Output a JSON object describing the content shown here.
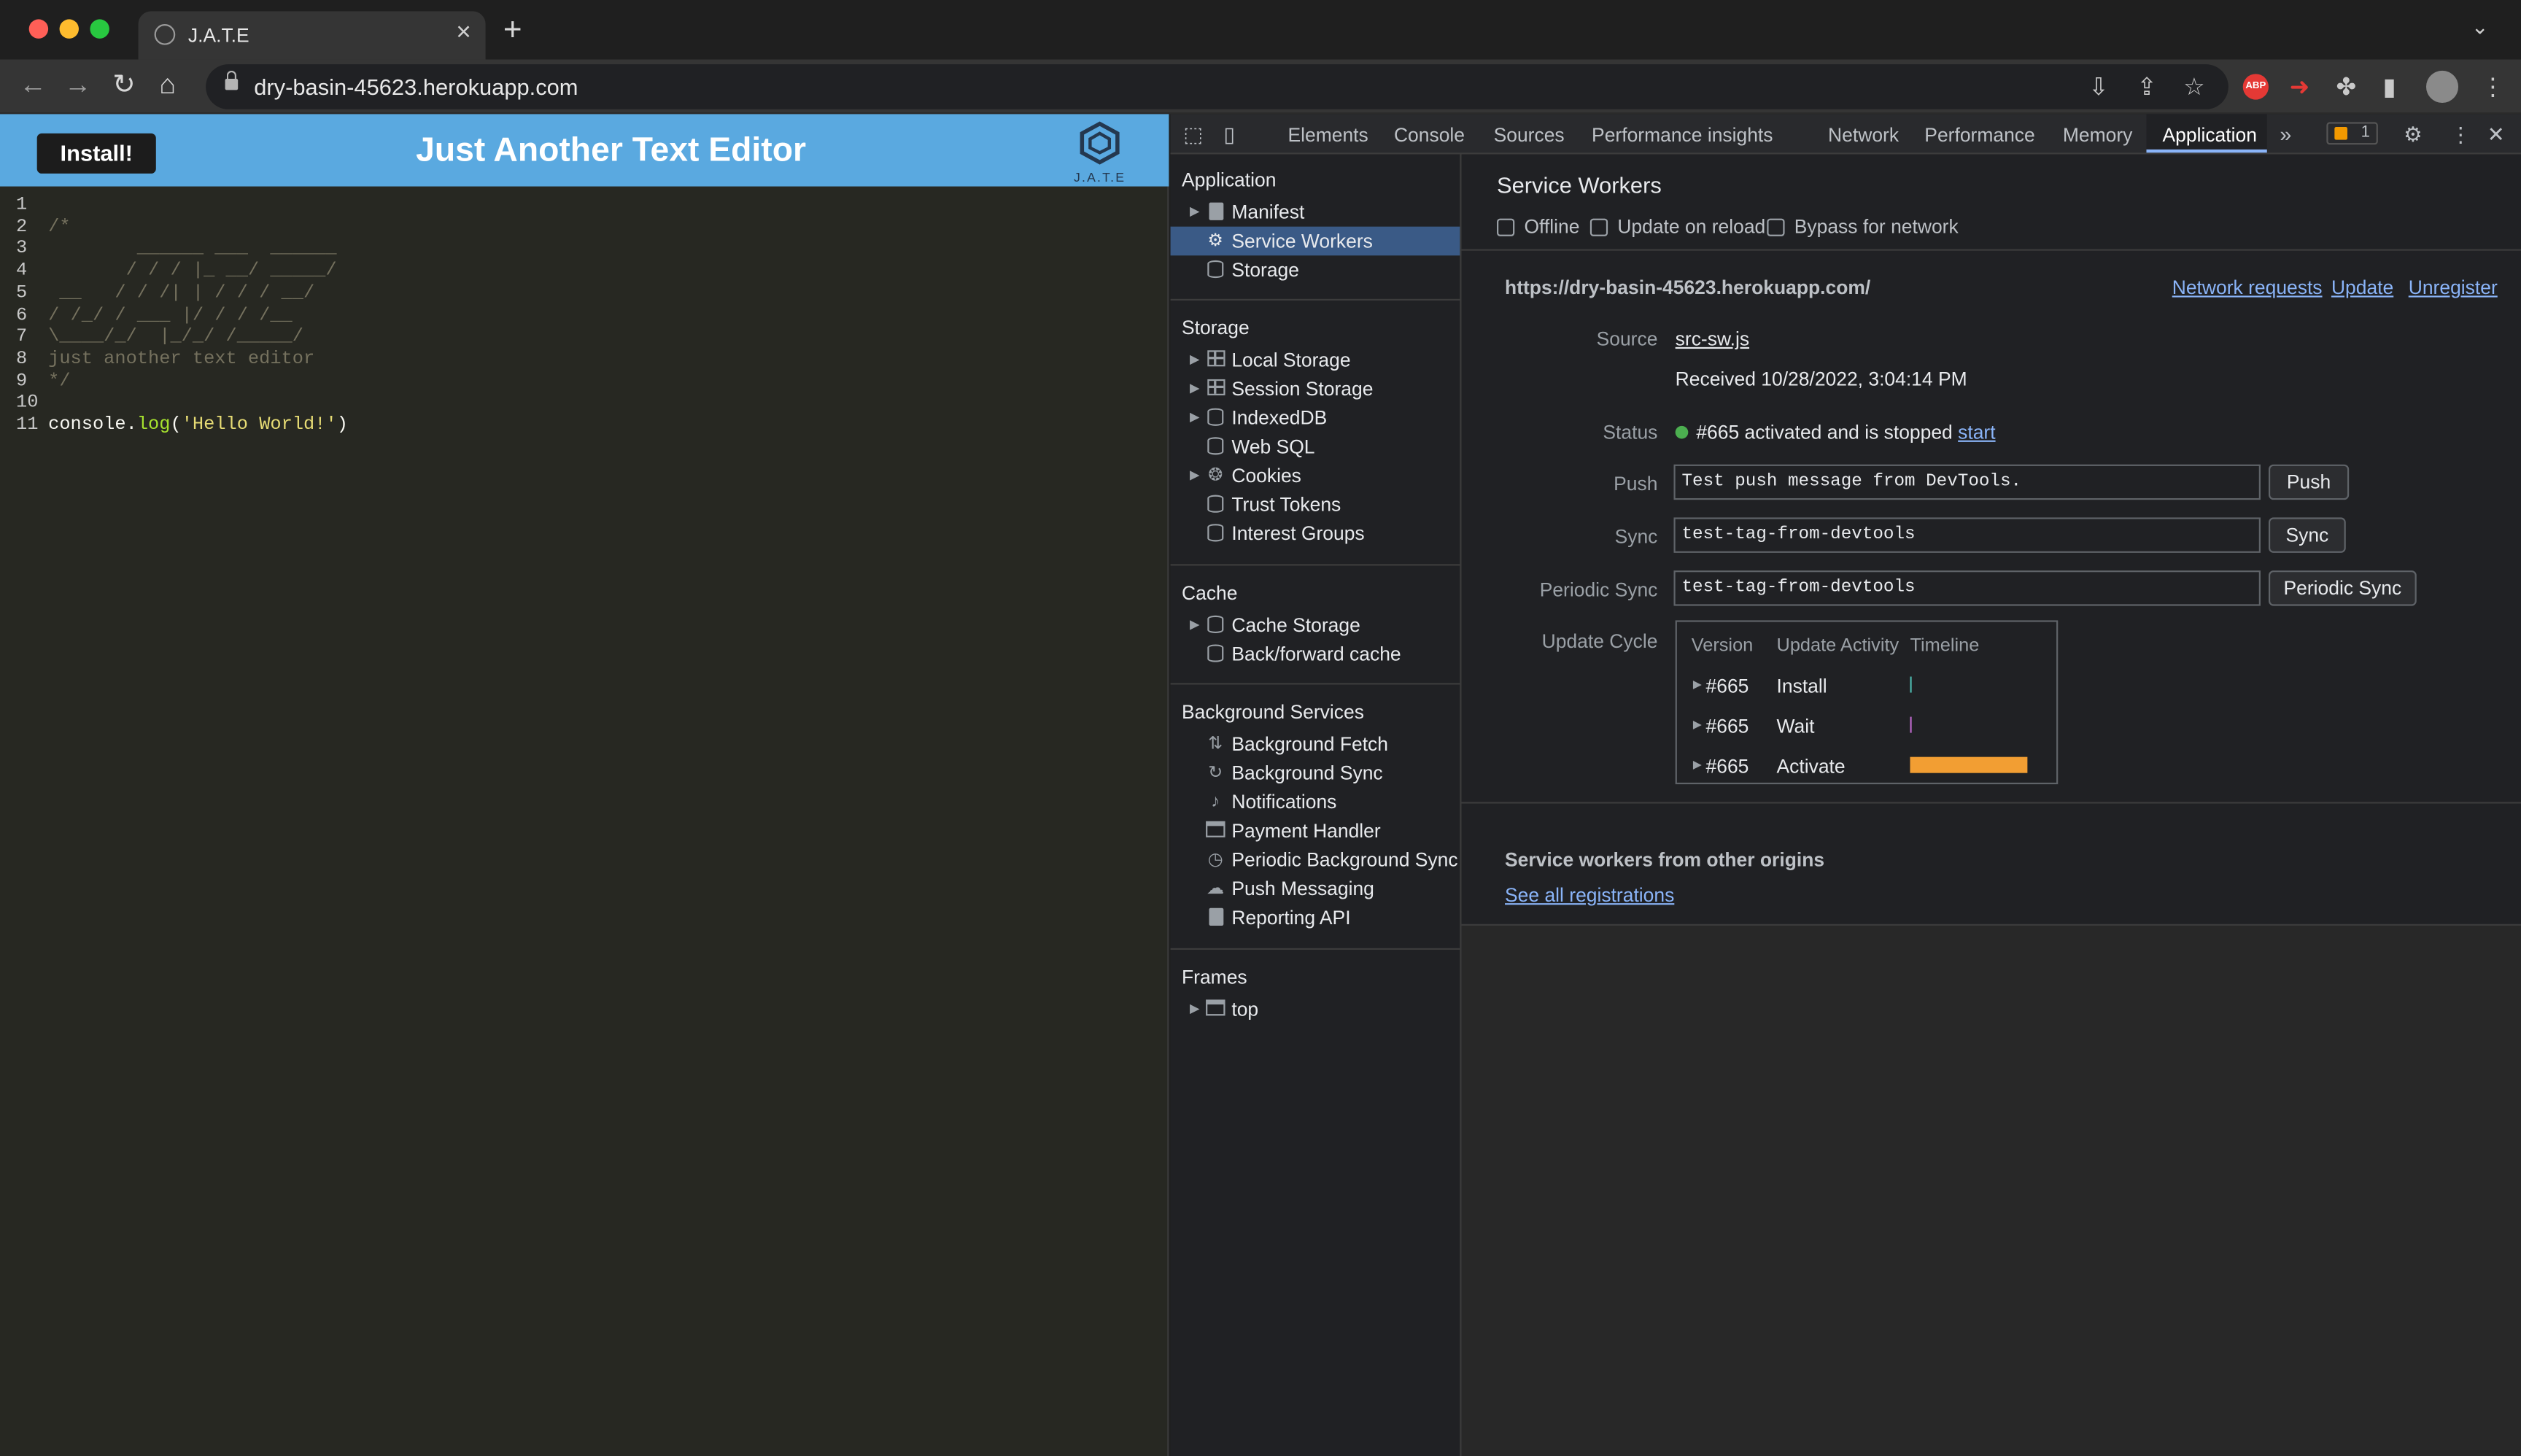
{
  "browser": {
    "tab_title": "J.A.T.E",
    "url": "dry-basin-45623.herokuapp.com",
    "extension_badge": "ABP"
  },
  "app": {
    "install_label": "Install!",
    "title": "Just Another Text Editor",
    "logo_text": "J.A.T.E",
    "editor_lines": [
      {
        "n": "1",
        "text": ""
      },
      {
        "n": "2",
        "text": "/*"
      },
      {
        "n": "3",
        "text": "        ______ ___  ______"
      },
      {
        "n": "4",
        "text": "       / / / |_ __/ _____/"
      },
      {
        "n": "5",
        "text": " __   / / /| | / / / __/"
      },
      {
        "n": "6",
        "text": "/ /_/ / ___ |/ / / /__"
      },
      {
        "n": "7",
        "text": "\\____/_/  |_/_/ /_____/"
      },
      {
        "n": "8",
        "text": "just another text editor"
      },
      {
        "n": "9",
        "text": "*/"
      },
      {
        "n": "10",
        "text": ""
      }
    ],
    "code_line_number": "11",
    "code_obj": "console",
    "code_dot": ".",
    "code_fn": "log",
    "code_open": "(",
    "code_str": "'Hello World!'",
    "code_close": ")"
  },
  "devtools": {
    "tabs": [
      "Elements",
      "Console",
      "Sources",
      "Performance insights",
      "Network",
      "Performance",
      "Memory",
      "Application"
    ],
    "active_tab": "Application",
    "issues_count": "1",
    "sidebar": {
      "application_title": "Application",
      "application_items": [
        "Manifest",
        "Service Workers",
        "Storage"
      ],
      "storage_title": "Storage",
      "storage_items": [
        "Local Storage",
        "Session Storage",
        "IndexedDB",
        "Web SQL",
        "Cookies",
        "Trust Tokens",
        "Interest Groups"
      ],
      "cache_title": "Cache",
      "cache_items": [
        "Cache Storage",
        "Back/forward cache"
      ],
      "bg_title": "Background Services",
      "bg_items": [
        "Background Fetch",
        "Background Sync",
        "Notifications",
        "Payment Handler",
        "Periodic Background Sync",
        "Push Messaging",
        "Reporting API"
      ],
      "frames_title": "Frames",
      "frames_items": [
        "top"
      ]
    },
    "sw": {
      "title": "Service Workers",
      "offline": "Offline",
      "update_on_reload": "Update on reload",
      "bypass": "Bypass for network",
      "origin": "https://dry-basin-45623.herokuapp.com/",
      "network_requests": "Network requests",
      "update": "Update",
      "unregister": "Unregister",
      "source_label": "Source",
      "source_file": "src-sw.js",
      "received": "Received 10/28/2022, 3:04:14 PM",
      "status_label": "Status",
      "status_text": "#665 activated and is stopped",
      "status_start": "start",
      "push_label": "Push",
      "push_value": "Test push message from DevTools.",
      "push_button": "Push",
      "sync_label": "Sync",
      "sync_value": "test-tag-from-devtools",
      "sync_button": "Sync",
      "periodic_label": "Periodic Sync",
      "periodic_value": "test-tag-from-devtools",
      "periodic_button": "Periodic Sync",
      "update_cycle_label": "Update Cycle",
      "uc_headers": [
        "Version",
        "Update Activity",
        "Timeline"
      ],
      "uc_rows": [
        {
          "version": "#665",
          "activity": "Install"
        },
        {
          "version": "#665",
          "activity": "Wait"
        },
        {
          "version": "#665",
          "activity": "Activate"
        }
      ],
      "other_title": "Service workers from other origins",
      "see_all": "See all registrations"
    }
  },
  "colors": {
    "app_header": "#5aa9e0",
    "selected_item": "#3a5a86",
    "activate_bar": "#f29e33",
    "status_dot": "#4caf50",
    "link": "#8ab4f8"
  }
}
